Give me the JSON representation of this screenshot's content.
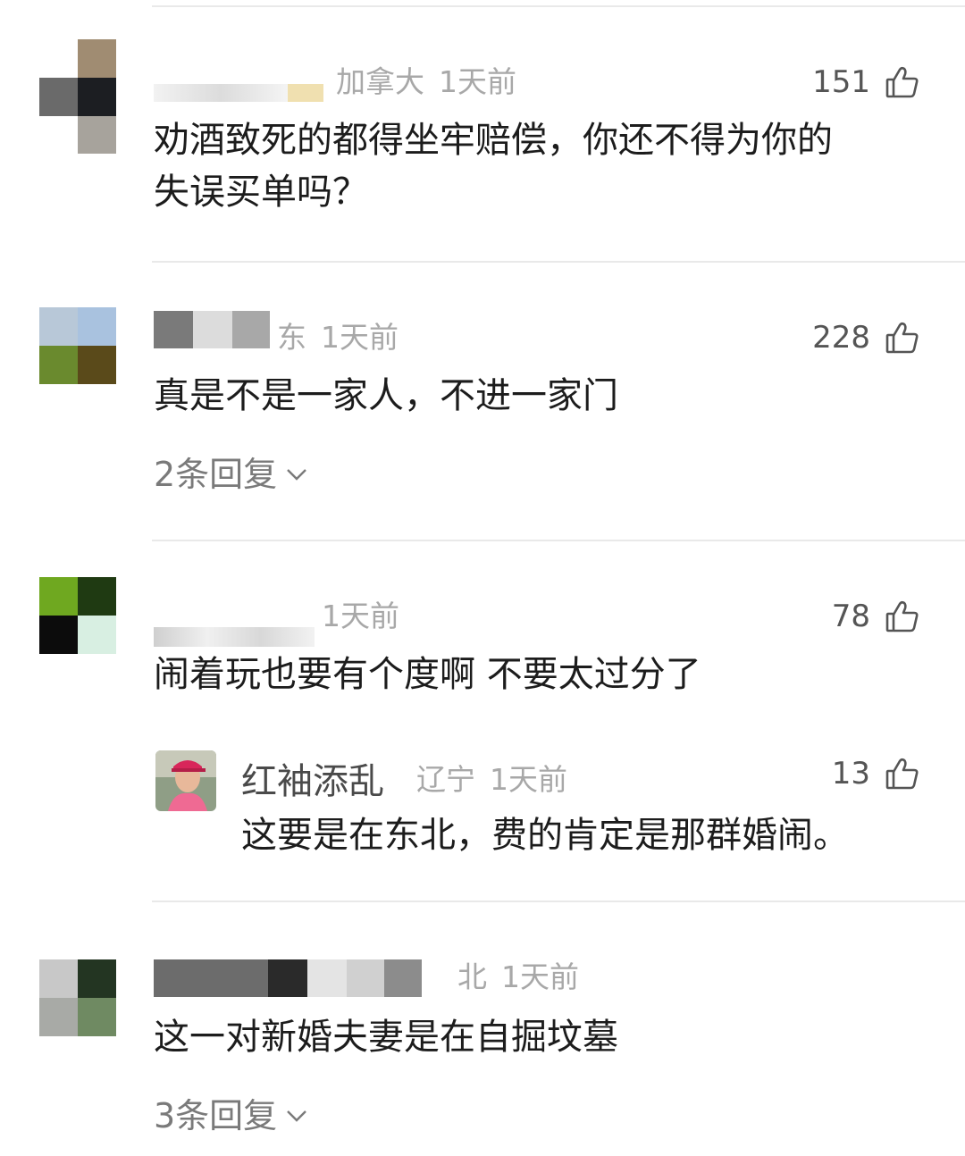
{
  "comments": [
    {
      "region": "加拿大",
      "time": "1天前",
      "likes": "151",
      "lines": [
        "劝酒致死的都得坐牢赔偿，你还不得为你的",
        "失误买单吗？"
      ]
    },
    {
      "region": "山东",
      "region_visible": "山东",
      "time": "1天前",
      "likes": "228",
      "lines": [
        "真是不是一家人，不进一家门"
      ],
      "replies": "2条回复"
    },
    {
      "time": "1天前",
      "likes": "78",
      "lines": [
        "闹着玩也要有个度啊  不要太过分了"
      ],
      "sub_reply": {
        "name": "红袖添乱",
        "region": "辽宁",
        "time": "1天前",
        "likes": "13",
        "text": "这要是在东北，费的肯定是那群婚闹。"
      }
    },
    {
      "region": "湖北",
      "time": "1天前",
      "lines": [
        "这一对新婚夫妻是在自掘坟墓"
      ],
      "replies": "3条回复"
    }
  ],
  "icons": {
    "like": "thumbs-up-icon",
    "expand": "chevron-down-icon"
  },
  "colors": {
    "meta_text": "#a8a8a8",
    "body_text": "#1c1c1c",
    "divider": "#e9e9e9"
  }
}
